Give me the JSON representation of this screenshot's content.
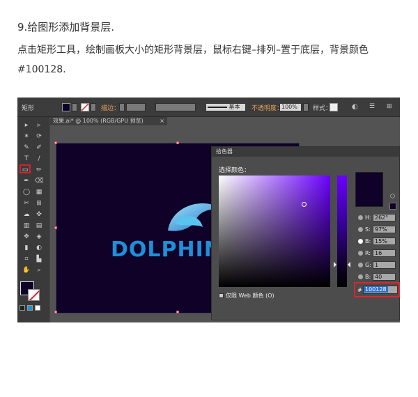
{
  "article": {
    "step_title": "9.给图形添加背景层.",
    "step_desc": "点击矩形工具，绘制画板大小的矩形背景层，鼠标右键–排列–置于底层，背景颜色#100128."
  },
  "controlbar": {
    "tool_name": "矩形",
    "stroke_label": "描边：",
    "brush_label": "基本",
    "opacity_label": "不透明度：",
    "opacity_value": "100%",
    "style_label": "样式："
  },
  "document": {
    "tab_title": "效果.ai* @ 100% (RGB/GPU 预览)",
    "tab_close": "×"
  },
  "tools": [
    "▸",
    "▹",
    "✶",
    "⟳",
    "✎",
    "✐",
    "T",
    "/",
    "▭",
    "✏",
    "✒",
    "⌫",
    "◯",
    "▦",
    "✂",
    "⊞",
    "☁",
    "✜",
    "▥",
    "▤",
    "✥",
    "◈",
    "▮",
    "◐",
    "⌗",
    "▙",
    "✋",
    "⌕"
  ],
  "artwork": {
    "logo_text": "DOLPHIN"
  },
  "color_picker": {
    "title": "拾色器",
    "select_label": "选择颜色：",
    "fields": [
      {
        "label": "H:",
        "value": "262°"
      },
      {
        "label": "S:",
        "value": "97%"
      },
      {
        "label": "B:",
        "value": "15%"
      },
      {
        "label": "R:",
        "value": "16"
      },
      {
        "label": "G:",
        "value": "1"
      },
      {
        "label": "B:",
        "value": "40"
      }
    ],
    "hex_prefix": "#",
    "hex_value": "100128",
    "web_only_label": "仅限 Web 颜色 (O)",
    "current_color": "#100128"
  },
  "colors": {
    "artboard_bg": "#100128",
    "highlight": "#e0242c",
    "logo_blue": "#1f8fd8"
  }
}
